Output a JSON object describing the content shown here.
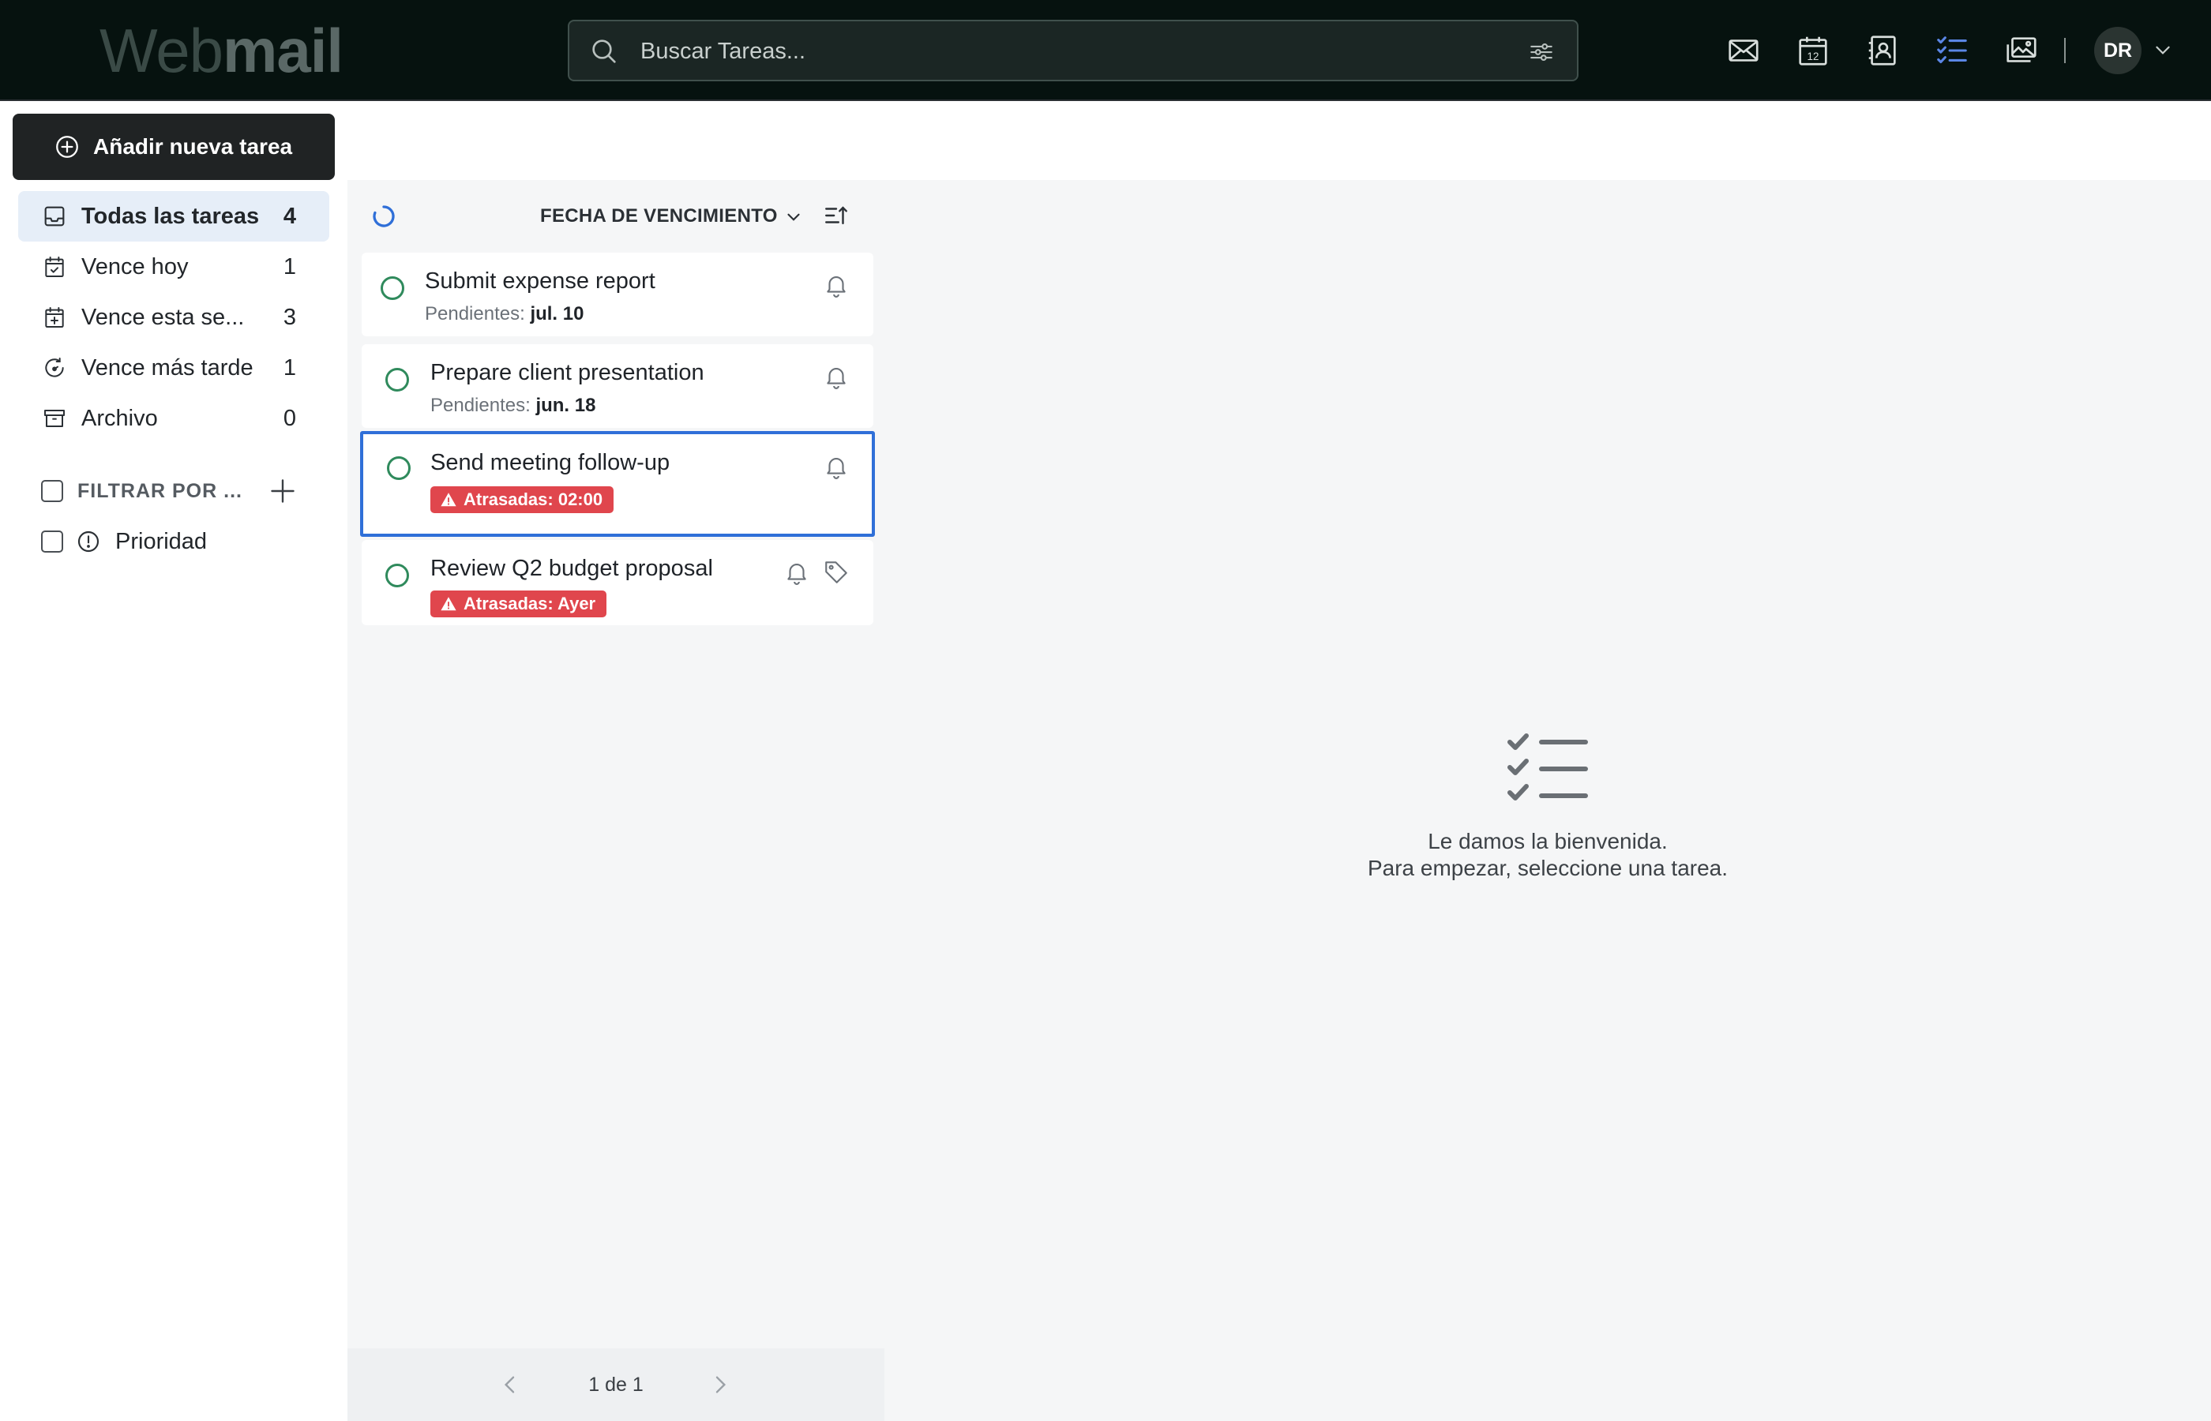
{
  "header": {
    "logo_light": "Web",
    "logo_bold": "mail",
    "search_placeholder": "Buscar Tareas...",
    "apps": [
      "mail-icon",
      "calendar-icon",
      "contacts-icon",
      "tasks-icon",
      "photos-icon"
    ],
    "calendar_day": "12",
    "active_app_color": "#5b86e5",
    "avatar_initials": "DR"
  },
  "sidebar": {
    "new_task_label": "Añadir nueva tarea",
    "items": [
      {
        "label": "Todas las tareas",
        "count": "4",
        "icon": "inbox-icon",
        "active": true
      },
      {
        "label": "Vence hoy",
        "count": "1",
        "icon": "calendar-check-icon",
        "active": false
      },
      {
        "label": "Vence esta se...",
        "count": "3",
        "icon": "calendar-plus-icon",
        "active": false
      },
      {
        "label": "Vence más tarde",
        "count": "1",
        "icon": "clock-forward-icon",
        "active": false
      },
      {
        "label": "Archivo",
        "count": "0",
        "icon": "archive-icon",
        "active": false
      }
    ],
    "filter_title": "FILTRAR POR ...",
    "filters": [
      {
        "label": "Prioridad",
        "icon": "alert-circle-icon"
      }
    ]
  },
  "task_list": {
    "sort_label": "FECHA DE VENCIMIENTO",
    "tasks": [
      {
        "title": "Submit expense report",
        "due_prefix": "Pendientes:",
        "due_value": "jul. 10",
        "overdue": false
      },
      {
        "title": "Prepare client presentation",
        "due_prefix": "Pendientes:",
        "due_value": "jun. 18",
        "overdue": false
      },
      {
        "title": "Send meeting follow-up",
        "badge": "Atrasadas: 02:00",
        "overdue": true,
        "selected": true
      },
      {
        "title": "Review Q2 budget proposal",
        "badge": "Atrasadas: Ayer",
        "overdue": true,
        "has_tag": true
      }
    ],
    "pagination": "1 de 1"
  },
  "detail": {
    "empty_line1": "Le damos la bienvenida.",
    "empty_line2": "Para empezar, seleccione una tarea."
  },
  "colors": {
    "topbar": "#06120f",
    "overdue_badge": "#e0464d",
    "selection_border": "#2f6fd8",
    "complete_circle": "#2f8a5c"
  }
}
